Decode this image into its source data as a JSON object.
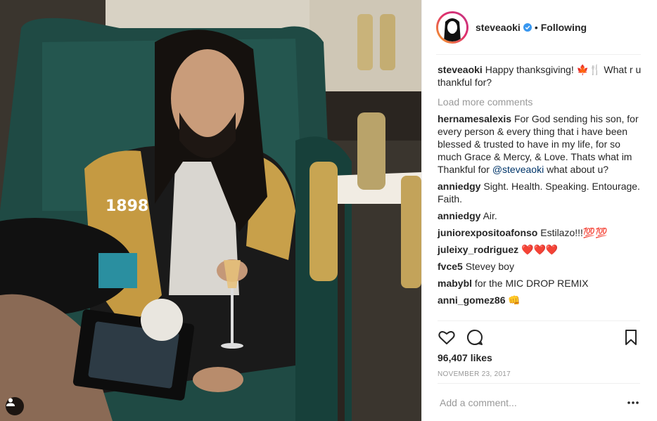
{
  "post": {
    "header": {
      "username": "steveaoki",
      "separator": "•",
      "follow_status": "Following"
    },
    "caption": {
      "user": "steveaoki",
      "text": "Happy thanksgiving! 🍁🍴 What r u thankful for?"
    },
    "load_more": "Load more comments",
    "comments": [
      {
        "user": "hernamesalexis",
        "text_before": "For God sending his son, for every person & every thing that i have been blessed & trusted to have in my life, for so much Grace & Mercy, & Love. Thats what im Thankful for ",
        "mention": "@steveaoki",
        "text_after": " what about u?"
      },
      {
        "user": "anniedgy",
        "text": "Sight. Health. Speaking. Entourage. Faith."
      },
      {
        "user": "anniedgy",
        "text": "Air."
      },
      {
        "user": "juniorexpositoafonso",
        "text": "Estilazo!!!💯💯"
      },
      {
        "user": "juleixy_rodriguez",
        "text": "❤️❤️❤️"
      },
      {
        "user": "fvce5",
        "text": "Stevey boy"
      },
      {
        "user": "mabybl",
        "text": "for the MIC DROP REMIX"
      },
      {
        "user": "anni_gomez86",
        "text": "👊"
      }
    ],
    "likes": "96,407 likes",
    "date": "NOVEMBER 23, 2017",
    "add_comment_placeholder": "Add a comment..."
  },
  "colors": {
    "link": "#003569",
    "verified": "#3897f0",
    "muted": "#999999",
    "border": "#efefef"
  }
}
